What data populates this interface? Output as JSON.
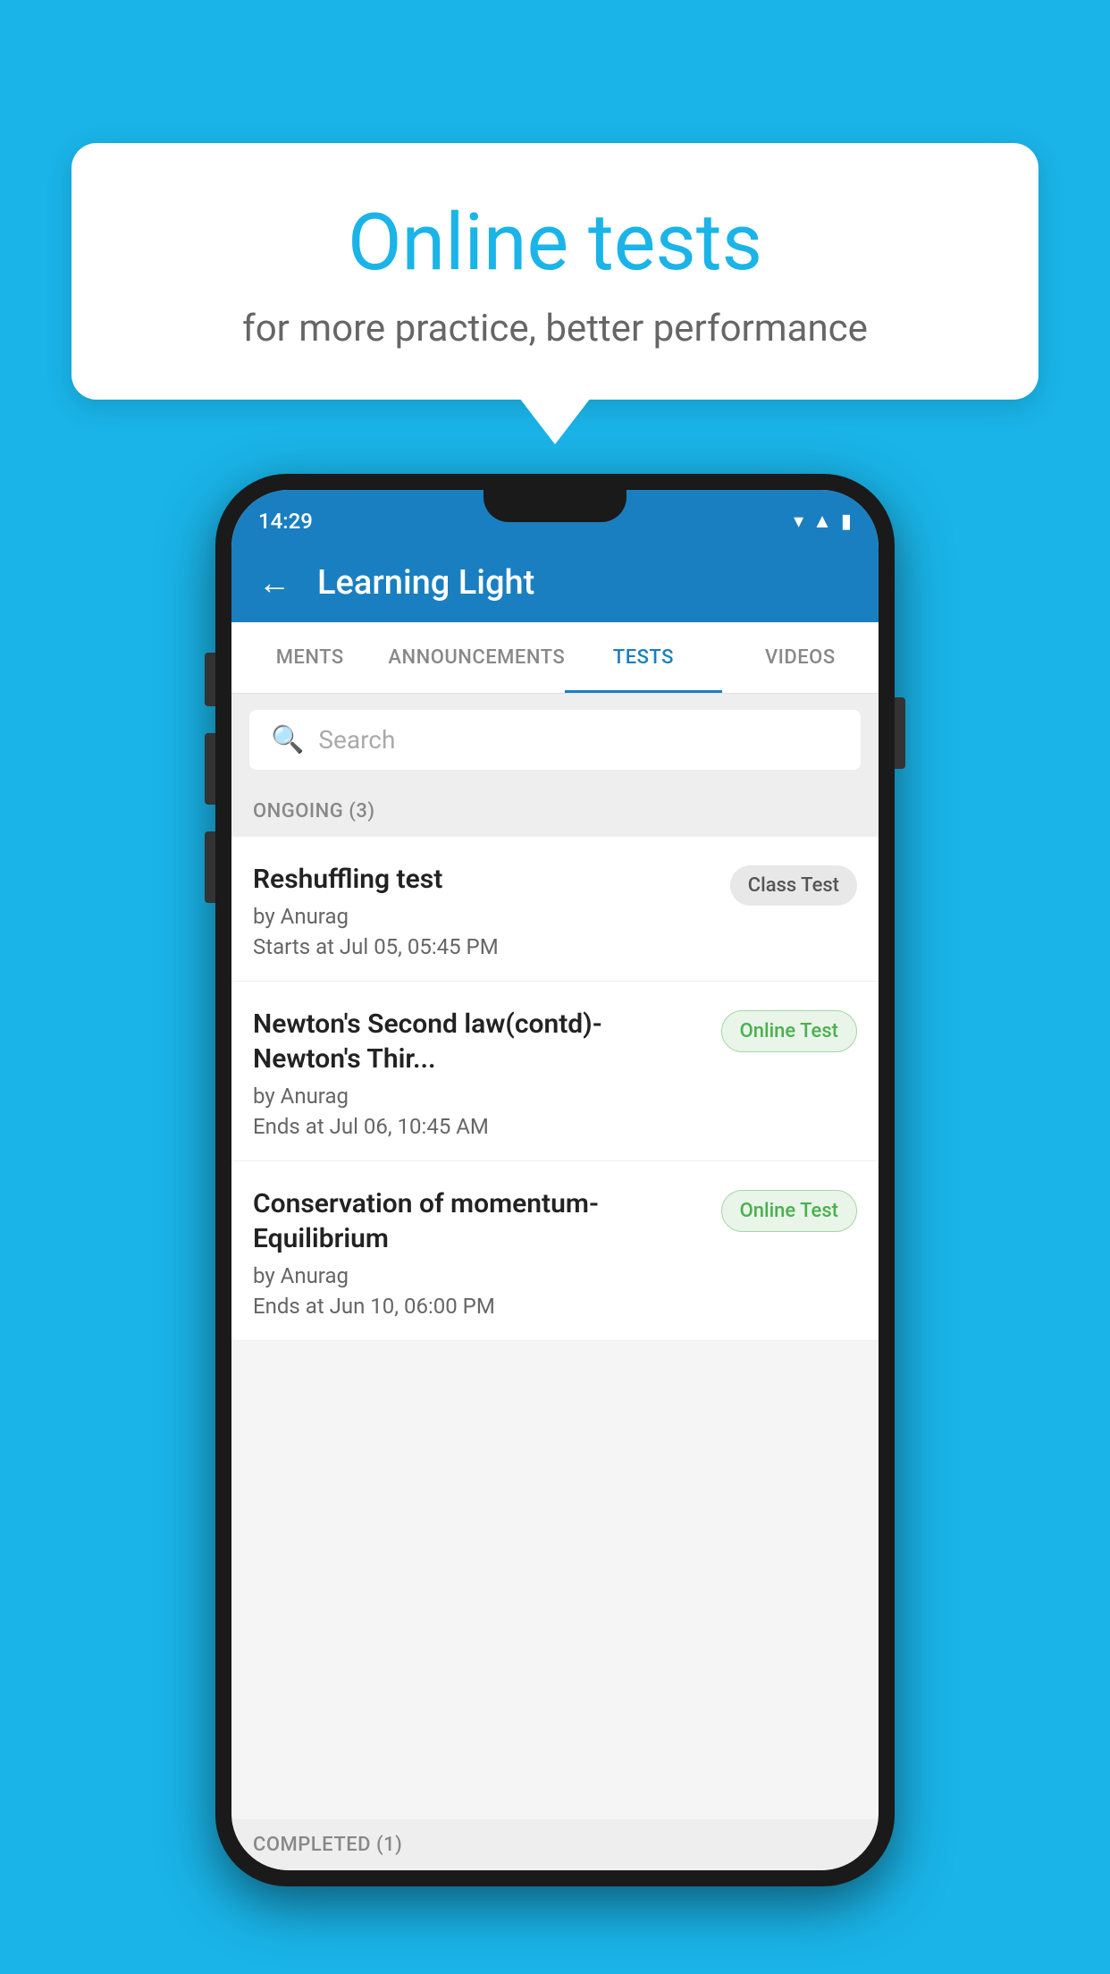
{
  "background_color": "#1ab4e8",
  "bubble": {
    "title": "Online tests",
    "subtitle": "for more practice, better performance"
  },
  "phone": {
    "status_bar": {
      "time": "14:29",
      "icons": [
        "wifi",
        "signal",
        "battery"
      ]
    },
    "app_bar": {
      "title": "Learning Light",
      "back_label": "←"
    },
    "tabs": [
      {
        "label": "MENTS",
        "active": false
      },
      {
        "label": "ANNOUNCEMENTS",
        "active": false
      },
      {
        "label": "TESTS",
        "active": true
      },
      {
        "label": "VIDEOS",
        "active": false
      }
    ],
    "search": {
      "placeholder": "Search"
    },
    "sections": [
      {
        "label": "ONGOING (3)",
        "tests": [
          {
            "name": "Reshuffling test",
            "by": "by Anurag",
            "date": "Starts at  Jul 05, 05:45 PM",
            "badge": "Class Test",
            "badge_type": "class"
          },
          {
            "name": "Newton's Second law(contd)-Newton's Thir...",
            "by": "by Anurag",
            "date": "Ends at  Jul 06, 10:45 AM",
            "badge": "Online Test",
            "badge_type": "online"
          },
          {
            "name": "Conservation of momentum-Equilibrium",
            "by": "by Anurag",
            "date": "Ends at  Jun 10, 06:00 PM",
            "badge": "Online Test",
            "badge_type": "online"
          }
        ]
      }
    ],
    "completed_section_label": "COMPLETED (1)"
  }
}
